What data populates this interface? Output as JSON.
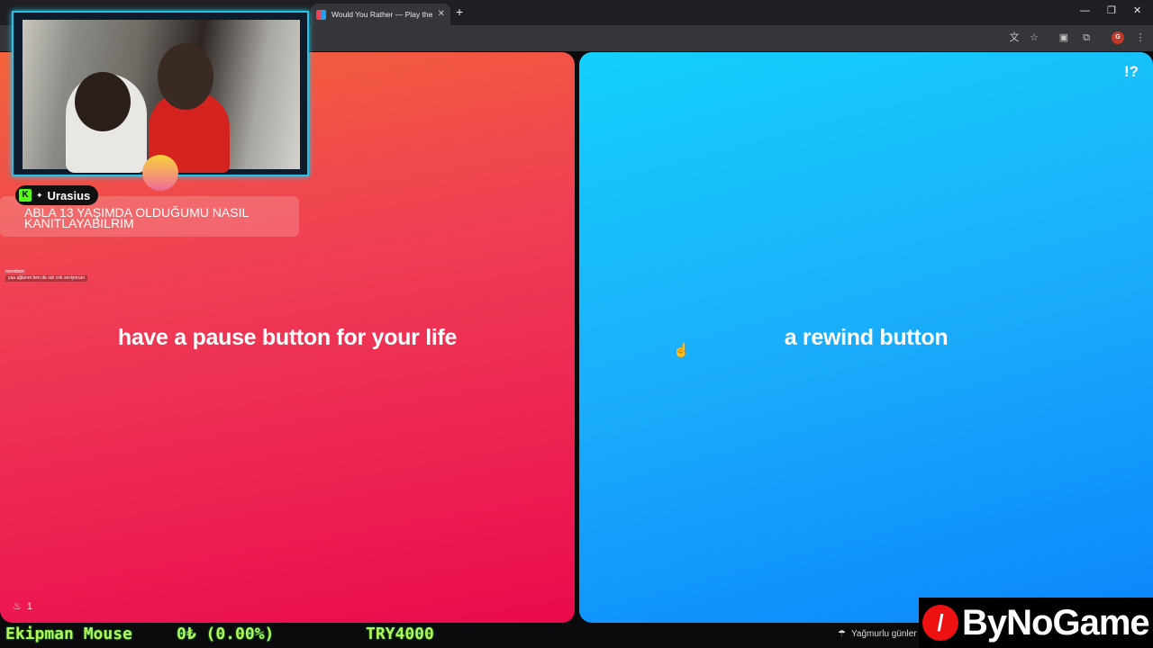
{
  "browser": {
    "tab_title": "Would You Rather — Play the G",
    "tab_close": "✕",
    "new_tab": "+",
    "window_controls": [
      "—",
      "❐",
      "✕"
    ],
    "toolbar_icons": [
      "translate-icon",
      "star-icon",
      "extension-icon",
      "puzzle-icon"
    ],
    "profile_initial": "G",
    "menu": "⋮"
  },
  "game": {
    "option_left": "have a pause button for your life",
    "option_right": "a rewind button",
    "help_label": "!?",
    "likes_count": "1",
    "colors": {
      "left": "#ef3d55",
      "right": "#1bb0fb"
    }
  },
  "stream": {
    "chat_username": "Urasius",
    "chat_message": "ABLA 13 YAŞIMDA OLDUĞUMU NASIL KANITLAYABILRIM",
    "mini_chat_user": "merwbsrc",
    "mini_chat_message": "yaa ağlarım ben de sizi cok seviyoruro",
    "ticker_item": "Ekipman Mouse",
    "ticker_value": "0₺ (0.00%)",
    "ticker_price": "TRY4000",
    "weather": "Yağmurlu günler",
    "logo": "ByNoGame"
  }
}
